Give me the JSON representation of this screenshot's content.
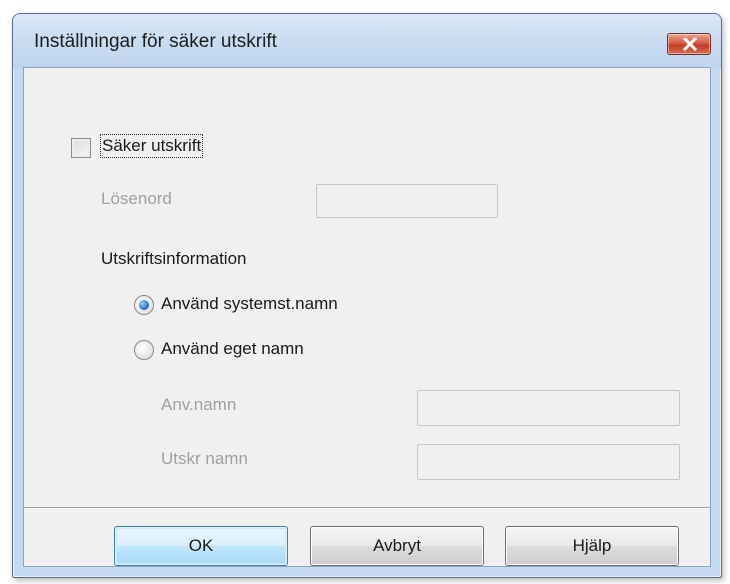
{
  "dialog": {
    "title": "Inställningar för säker utskrift",
    "close_icon": "close-x-icon",
    "colors": {
      "close_button": "#c8452e",
      "client_bg": "#f0f0f0",
      "frame": "#c4daf1"
    }
  },
  "secure_print": {
    "checkbox_label": "Säker utskrift",
    "checked": false
  },
  "password": {
    "label": "Lösenord",
    "value": "",
    "enabled": false
  },
  "print_info": {
    "heading": "Utskriftsinformation",
    "options": [
      {
        "label": "Använd systemst.namn",
        "selected": true
      },
      {
        "label": "Använd eget namn",
        "selected": false
      }
    ]
  },
  "user_name": {
    "label": "Anv.namn",
    "value": "",
    "enabled": false
  },
  "job_name": {
    "label": "Utskr namn",
    "value": "",
    "enabled": false
  },
  "buttons": {
    "ok": "OK",
    "cancel": "Avbryt",
    "help": "Hjälp"
  }
}
